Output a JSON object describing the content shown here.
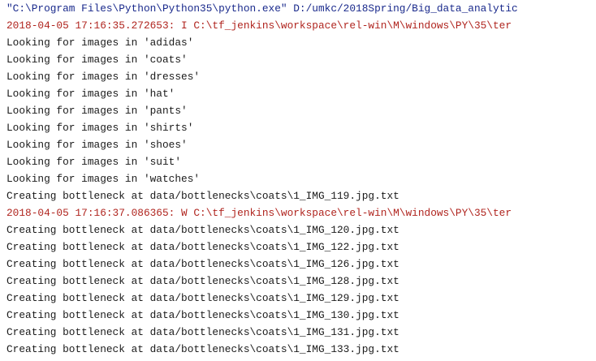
{
  "console": {
    "lines": [
      {
        "type": "cmd",
        "text": "\"C:\\Program Files\\Python\\Python35\\python.exe\" D:/umkc/2018Spring/Big_data_analytic"
      },
      {
        "type": "err",
        "text": "2018-04-05 17:16:35.272653: I C:\\tf_jenkins\\workspace\\rel-win\\M\\windows\\PY\\35\\ter"
      },
      {
        "type": "out",
        "text": "Looking for images in 'adidas'"
      },
      {
        "type": "out",
        "text": "Looking for images in 'coats'"
      },
      {
        "type": "out",
        "text": "Looking for images in 'dresses'"
      },
      {
        "type": "out",
        "text": "Looking for images in 'hat'"
      },
      {
        "type": "out",
        "text": "Looking for images in 'pants'"
      },
      {
        "type": "out",
        "text": "Looking for images in 'shirts'"
      },
      {
        "type": "out",
        "text": "Looking for images in 'shoes'"
      },
      {
        "type": "out",
        "text": "Looking for images in 'suit'"
      },
      {
        "type": "out",
        "text": "Looking for images in 'watches'"
      },
      {
        "type": "out",
        "text": "Creating bottleneck at data/bottlenecks\\coats\\1_IMG_119.jpg.txt"
      },
      {
        "type": "err",
        "text": "2018-04-05 17:16:37.086365: W C:\\tf_jenkins\\workspace\\rel-win\\M\\windows\\PY\\35\\ter"
      },
      {
        "type": "out",
        "text": "Creating bottleneck at data/bottlenecks\\coats\\1_IMG_120.jpg.txt"
      },
      {
        "type": "out",
        "text": "Creating bottleneck at data/bottlenecks\\coats\\1_IMG_122.jpg.txt"
      },
      {
        "type": "out",
        "text": "Creating bottleneck at data/bottlenecks\\coats\\1_IMG_126.jpg.txt"
      },
      {
        "type": "out",
        "text": "Creating bottleneck at data/bottlenecks\\coats\\1_IMG_128.jpg.txt"
      },
      {
        "type": "out",
        "text": "Creating bottleneck at data/bottlenecks\\coats\\1_IMG_129.jpg.txt"
      },
      {
        "type": "out",
        "text": "Creating bottleneck at data/bottlenecks\\coats\\1_IMG_130.jpg.txt"
      },
      {
        "type": "out",
        "text": "Creating bottleneck at data/bottlenecks\\coats\\1_IMG_131.jpg.txt"
      },
      {
        "type": "out",
        "text": "Creating bottleneck at data/bottlenecks\\coats\\1_IMG_133.jpg.txt"
      }
    ]
  },
  "colors": {
    "command": "#1a2a8c",
    "stderr": "#b0251f",
    "stdout": "#1a1a1a",
    "background": "#ffffff"
  }
}
